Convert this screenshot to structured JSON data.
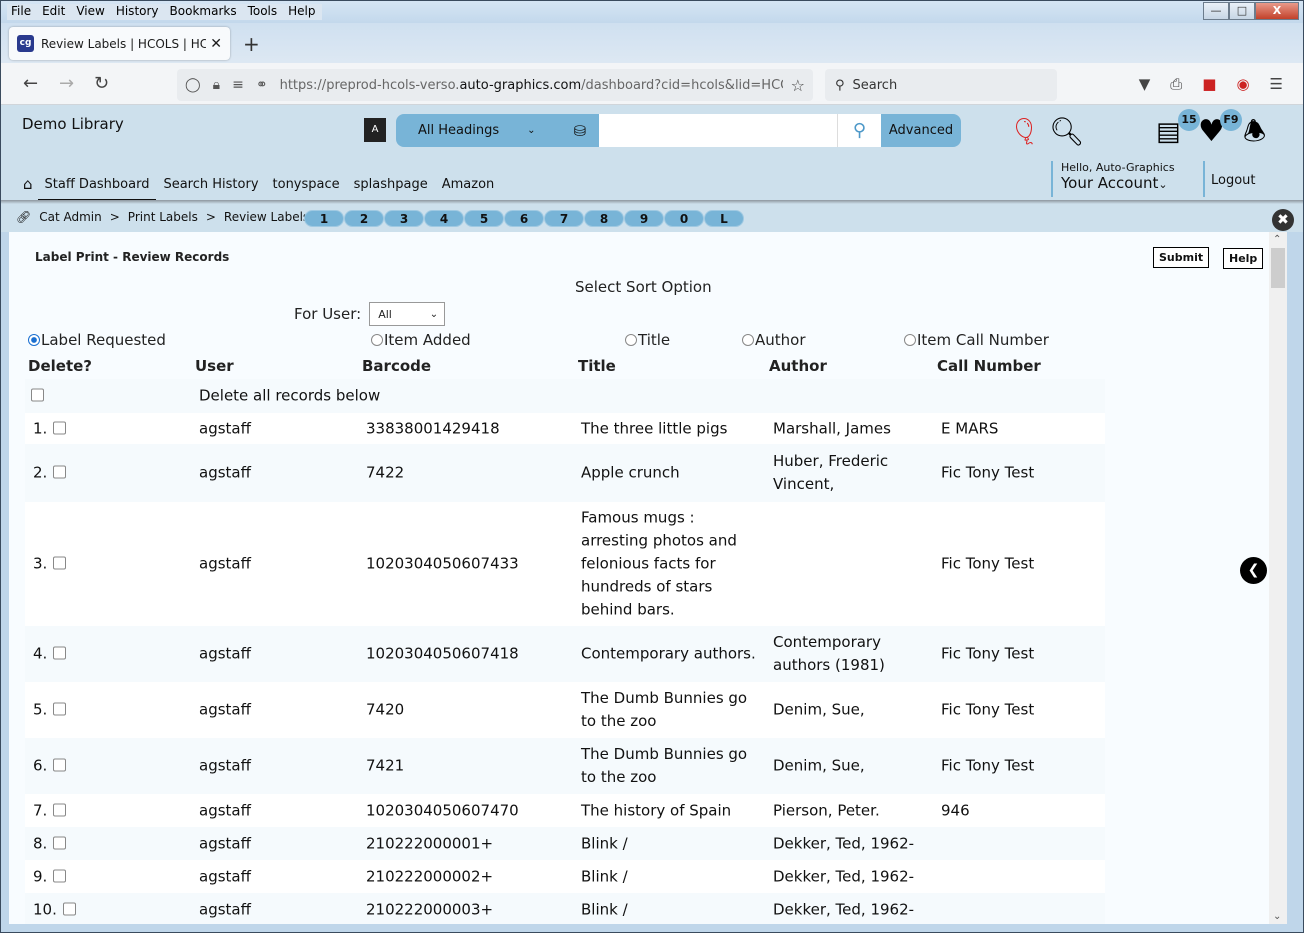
{
  "browser": {
    "menu": [
      "File",
      "Edit",
      "View",
      "History",
      "Bookmarks",
      "Tools",
      "Help"
    ],
    "tab_title": "Review Labels | HCOLS | HCOLS",
    "favicon": "cg",
    "url_prefix": "https://preprod-hcols-verso.",
    "url_domain": "auto-graphics.com",
    "url_suffix": "/dashboard?cid=hcols&lid=HCO",
    "search_placeholder": "Search"
  },
  "header": {
    "library_name": "Demo Library",
    "heading_select": "All Headings",
    "search_value": "",
    "advanced_label": "Advanced",
    "list_badge": "15",
    "favorites_badge": "F9",
    "nav": [
      "Staff Dashboard",
      "Search History",
      "tonyspace",
      "splashpage",
      "Amazon"
    ],
    "hello": "Hello, Auto-Graphics",
    "account": "Your Account",
    "logout": "Logout"
  },
  "breadcrumb": {
    "items": [
      "Cat Admin",
      "Print Labels",
      "Review Labels"
    ],
    "separator": ">",
    "pills": [
      "1",
      "2",
      "3",
      "4",
      "5",
      "6",
      "7",
      "8",
      "9",
      "0",
      "L"
    ]
  },
  "page": {
    "title": "Label Print - Review Records",
    "submit": "Submit",
    "help": "Help",
    "sort_label": "Select Sort Option",
    "for_user_label": "For User:",
    "for_user_value": "All",
    "sort_options": [
      {
        "label": "Label Requested",
        "selected": true
      },
      {
        "label": "Item Added",
        "selected": false
      },
      {
        "label": "Title",
        "selected": false
      },
      {
        "label": "Author",
        "selected": false
      },
      {
        "label": "Item Call Number",
        "selected": false
      }
    ],
    "columns": [
      "Delete?",
      "User",
      "Barcode",
      "Title",
      "Author",
      "Call Number"
    ],
    "delete_all_label": "Delete all records below",
    "rows": [
      {
        "num": "1.",
        "user": "agstaff",
        "barcode": "33838001429418",
        "title": "The three little pigs",
        "author": "Marshall, James",
        "call": "E MARS"
      },
      {
        "num": "2.",
        "user": "agstaff",
        "barcode": "7422",
        "title": "Apple crunch",
        "author": "Huber, Frederic Vincent,",
        "call": "Fic Tony Test"
      },
      {
        "num": "3.",
        "user": "agstaff",
        "barcode": "1020304050607433",
        "title": "Famous mugs : arresting photos and felonious facts for hundreds of stars behind bars.",
        "author": "",
        "call": "Fic Tony Test"
      },
      {
        "num": "4.",
        "user": "agstaff",
        "barcode": "1020304050607418",
        "title": "Contemporary authors.",
        "author": "Contemporary authors (1981)",
        "call": "Fic Tony Test"
      },
      {
        "num": "5.",
        "user": "agstaff",
        "barcode": "7420",
        "title": "The Dumb Bunnies go to the zoo",
        "author": "Denim, Sue,",
        "call": "Fic Tony Test"
      },
      {
        "num": "6.",
        "user": "agstaff",
        "barcode": "7421",
        "title": "The Dumb Bunnies go to the zoo",
        "author": "Denim, Sue,",
        "call": "Fic Tony Test"
      },
      {
        "num": "7.",
        "user": "agstaff",
        "barcode": "1020304050607470",
        "title": "The history of Spain",
        "author": "Pierson, Peter.",
        "call": "946"
      },
      {
        "num": "8.",
        "user": "agstaff",
        "barcode": "210222000001+",
        "title": "Blink /",
        "author": "Dekker, Ted, 1962-",
        "call": ""
      },
      {
        "num": "9.",
        "user": "agstaff",
        "barcode": "210222000002+",
        "title": "Blink /",
        "author": "Dekker, Ted, 1962-",
        "call": ""
      },
      {
        "num": "10.",
        "user": "agstaff",
        "barcode": "210222000003+",
        "title": "Blink /",
        "author": "Dekker, Ted, 1962-",
        "call": ""
      }
    ]
  },
  "colors": {
    "header_bg": "#cde0ec",
    "accent": "#78b4d7",
    "content_bg": "#f8fcff"
  }
}
